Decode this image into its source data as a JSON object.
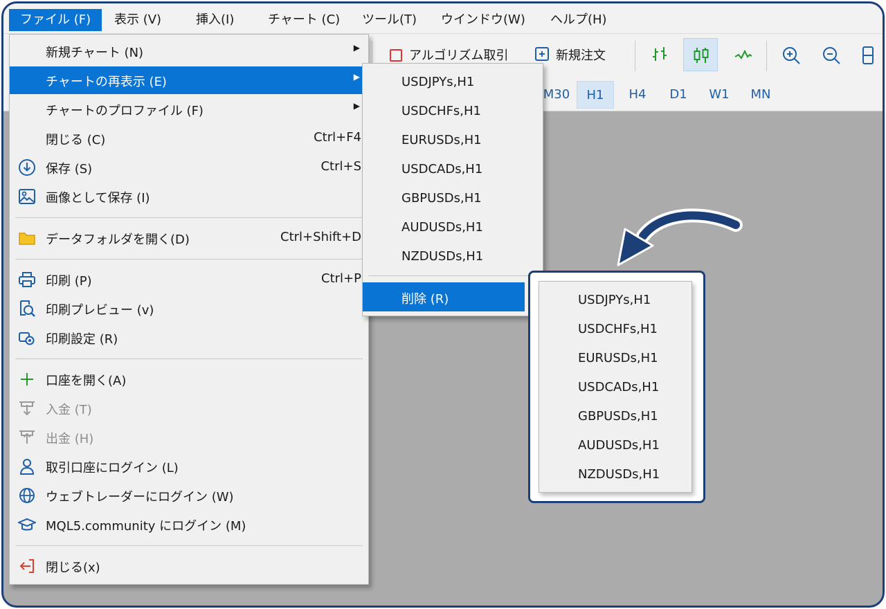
{
  "menubar": {
    "items": [
      {
        "label": "ファイル (F)",
        "active": true
      },
      {
        "label": "表示 (V)"
      },
      {
        "label": "挿入(I)"
      },
      {
        "label": "チャート (C)"
      },
      {
        "label": "ツール(T)"
      },
      {
        "label": "ウインドウ(W)"
      },
      {
        "label": "ヘルプ(H)"
      }
    ]
  },
  "toolbar": {
    "algo_label": "アルゴリズム取引",
    "new_order_label": "新規注文",
    "timeframes": [
      "M30",
      "H1",
      "H4",
      "D1",
      "W1",
      "MN"
    ],
    "selected_timeframe": "H1"
  },
  "file_menu": {
    "items": [
      {
        "label": "新規チャート (N)",
        "submenu": true
      },
      {
        "label": "チャートの再表示 (E)",
        "submenu": true,
        "highlighted": true
      },
      {
        "label": "チャートのプロファイル (F)",
        "submenu": true
      },
      {
        "label": "閉じる (C)",
        "shortcut": "Ctrl+F4"
      },
      {
        "label": "保存 (S)",
        "shortcut": "Ctrl+S",
        "icon": "save-icon"
      },
      {
        "label": "画像として保存 (I)",
        "icon": "image-icon"
      },
      {
        "label": "データフォルダを開く(D)",
        "shortcut": "Ctrl+Shift+D",
        "icon": "folder-icon"
      },
      {
        "label": "印刷 (P)",
        "shortcut": "Ctrl+P",
        "icon": "printer-icon"
      },
      {
        "label": "印刷プレビュー (v)",
        "icon": "print-preview-icon"
      },
      {
        "label": "印刷設定 (R)",
        "icon": "print-settings-icon"
      },
      {
        "label": "口座を開く(A)",
        "icon": "plus-icon"
      },
      {
        "label": "入金 (T)",
        "icon": "deposit-icon",
        "disabled": true
      },
      {
        "label": "出金 (H)",
        "icon": "withdraw-icon",
        "disabled": true
      },
      {
        "label": "取引口座にログイン (L)",
        "icon": "user-icon"
      },
      {
        "label": "ウェブトレーダーにログイン (W)",
        "icon": "globe-icon"
      },
      {
        "label": "MQL5.community にログイン (M)",
        "icon": "graduation-cap-icon"
      },
      {
        "label": "閉じる(x)",
        "icon": "exit-icon"
      }
    ]
  },
  "reopen_submenu": {
    "items": [
      "USDJPYs,H1",
      "USDCHFs,H1",
      "EURUSDs,H1",
      "USDCADs,H1",
      "GBPUSDs,H1",
      "AUDUSDs,H1",
      "NZDUSDs,H1"
    ],
    "delete_label": "削除 (R)"
  },
  "delete_submenu": {
    "items": [
      "USDJPYs,H1",
      "USDCHFs,H1",
      "EURUSDs,H1",
      "USDCADs,H1",
      "GBPUSDs,H1",
      "AUDUSDs,H1",
      "NZDUSDs,H1"
    ]
  },
  "colors": {
    "highlight": "#0a74d4",
    "callout_border": "#1d3f78",
    "workspace": "#ababab"
  }
}
